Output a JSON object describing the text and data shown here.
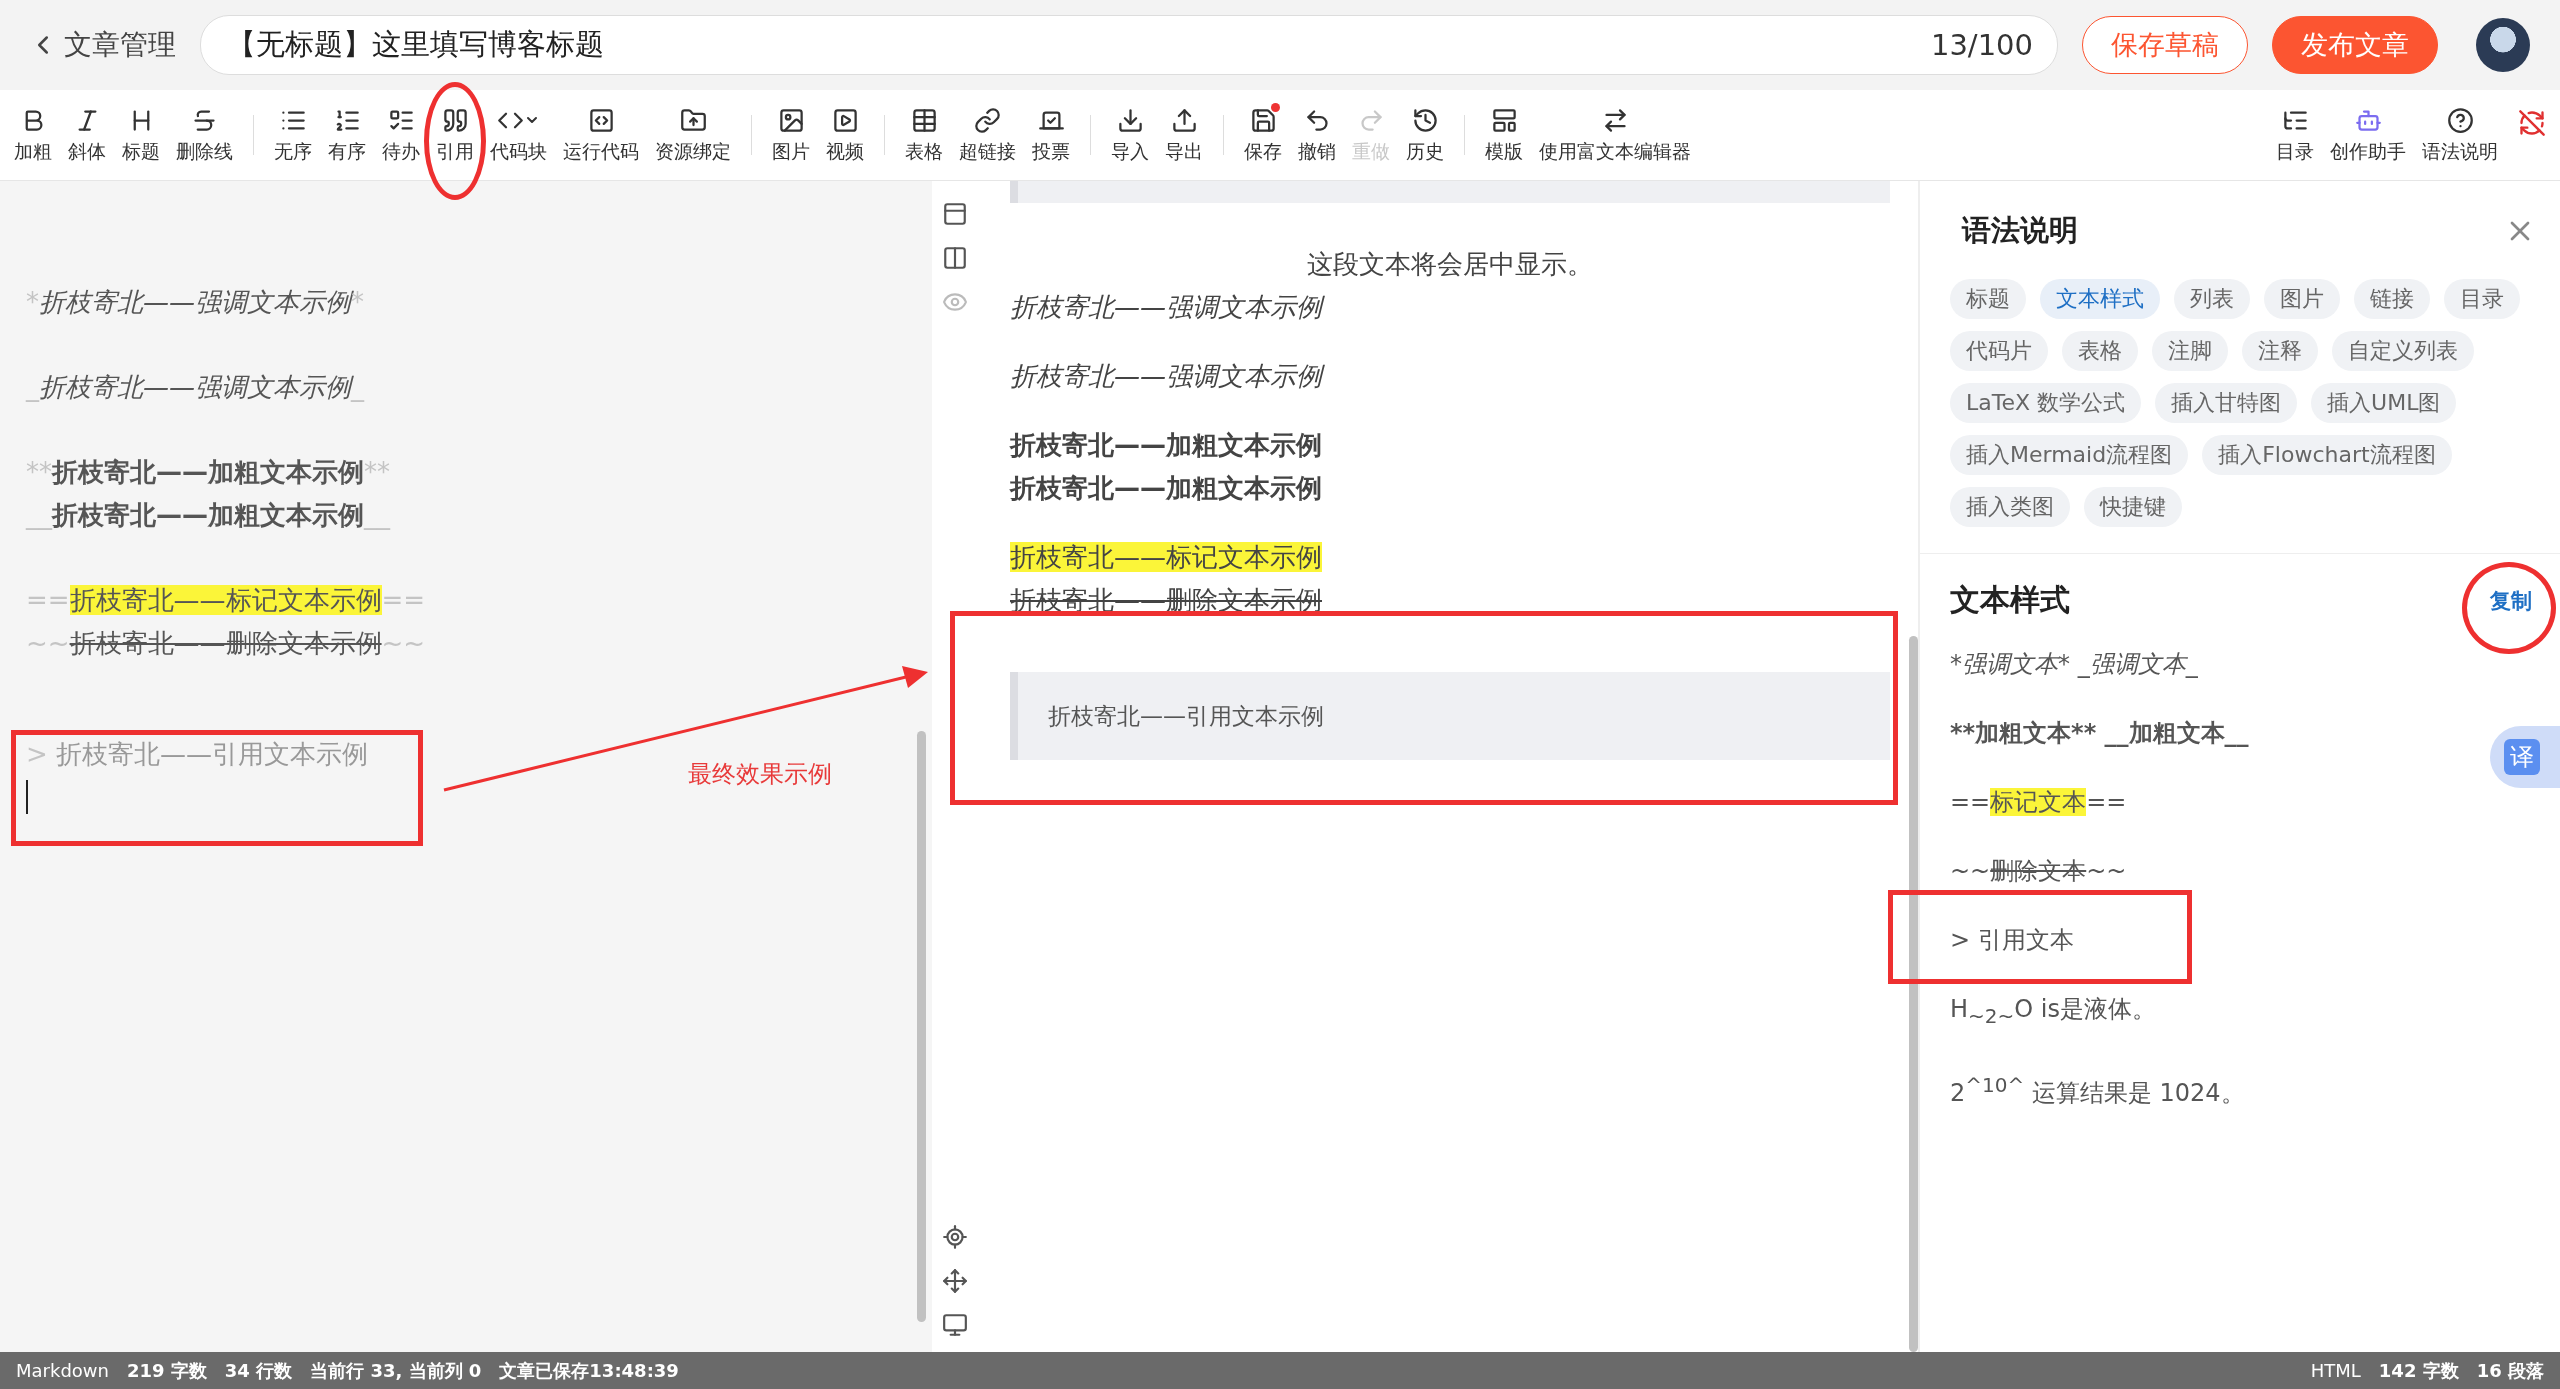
{
  "header": {
    "back_label": "文章管理",
    "title_field": {
      "value": "【无标题】这里填写博客标题"
    },
    "counter": "13/100",
    "save_draft": "保存草稿",
    "publish": "发布文章"
  },
  "toolbar": {
    "groups": [
      {
        "items": [
          {
            "label": "加粗",
            "disabled": false,
            "dot": false,
            "dropdown": false
          },
          {
            "label": "斜体",
            "disabled": false,
            "dot": false,
            "dropdown": false
          },
          {
            "label": "标题",
            "disabled": false,
            "dot": false,
            "dropdown": false
          },
          {
            "label": "删除线",
            "disabled": false,
            "dot": false,
            "dropdown": false
          }
        ]
      },
      {
        "items": [
          {
            "label": "无序",
            "disabled": false,
            "dot": false,
            "dropdown": false
          },
          {
            "label": "有序",
            "disabled": false,
            "dot": false,
            "dropdown": false
          },
          {
            "label": "待办",
            "disabled": false,
            "dot": false,
            "dropdown": false
          },
          {
            "label": "引用",
            "disabled": false,
            "dot": false,
            "dropdown": false
          },
          {
            "label": "代码块",
            "disabled": false,
            "dot": false,
            "dropdown": true
          },
          {
            "label": "运行代码",
            "disabled": false,
            "dot": false,
            "dropdown": false
          },
          {
            "label": "资源绑定",
            "disabled": false,
            "dot": false,
            "dropdown": false
          }
        ]
      },
      {
        "items": [
          {
            "label": "图片",
            "disabled": false,
            "dot": false,
            "dropdown": false
          },
          {
            "label": "视频",
            "disabled": false,
            "dot": false,
            "dropdown": false
          }
        ]
      },
      {
        "items": [
          {
            "label": "表格",
            "disabled": false,
            "dot": false,
            "dropdown": false
          },
          {
            "label": "超链接",
            "disabled": false,
            "dot": false,
            "dropdown": false
          },
          {
            "label": "投票",
            "disabled": false,
            "dot": false,
            "dropdown": false
          }
        ]
      },
      {
        "items": [
          {
            "label": "导入",
            "disabled": false,
            "dot": false,
            "dropdown": false
          },
          {
            "label": "导出",
            "disabled": false,
            "dot": false,
            "dropdown": false
          }
        ]
      },
      {
        "items": [
          {
            "label": "保存",
            "disabled": false,
            "dot": true,
            "dropdown": false
          },
          {
            "label": "撤销",
            "disabled": false,
            "dot": false,
            "dropdown": false
          },
          {
            "label": "重做",
            "disabled": true,
            "dot": false,
            "dropdown": false
          },
          {
            "label": "历史",
            "disabled": false,
            "dot": false,
            "dropdown": false
          }
        ]
      },
      {
        "items": [
          {
            "label": "模版",
            "disabled": false,
            "dot": false,
            "dropdown": false
          },
          {
            "label": "使用富文本编辑器",
            "disabled": false,
            "dot": false,
            "dropdown": false
          }
        ]
      }
    ],
    "right_items": [
      {
        "label": "目录"
      },
      {
        "label": "创作助手"
      },
      {
        "label": "语法说明"
      }
    ]
  },
  "editor": {
    "blocks": [
      {
        "lines": [
          {
            "kind": "italic",
            "prefix": "*",
            "text": "折枝寄北——强调文本示例",
            "suffix": "*"
          }
        ]
      },
      {
        "lines": [
          {
            "kind": "italic",
            "prefix": "_",
            "text": "折枝寄北——强调文本示例",
            "suffix": "_"
          }
        ]
      },
      {
        "lines": [
          {
            "kind": "bold",
            "prefix": "**",
            "text": "折枝寄北——加粗文本示例",
            "suffix": "**"
          },
          {
            "kind": "bold",
            "prefix": "__",
            "text": "折枝寄北——加粗文本示例",
            "suffix": "__"
          }
        ]
      },
      {
        "lines": [
          {
            "kind": "mark",
            "prefix": "==",
            "text": "折枝寄北——标记文本示例",
            "suffix": "=="
          },
          {
            "kind": "strike",
            "prefix": "~~",
            "text": "折枝寄北——删除文本示例",
            "suffix": "~~"
          }
        ]
      },
      {
        "lines": [
          {
            "kind": "quote",
            "prefix": ">",
            "text": "折枝寄北——引用文本示例"
          },
          {
            "kind": "cursor"
          }
        ]
      }
    ]
  },
  "annotation": {
    "label": "最终效果示例"
  },
  "preview": {
    "blocks": [
      {
        "lines": [
          {
            "kind": "center",
            "text": "这段文本将会居中显示。"
          },
          {
            "kind": "italic",
            "text": "折枝寄北——强调文本示例"
          }
        ]
      },
      {
        "lines": [
          {
            "kind": "italic",
            "text": "折枝寄北——强调文本示例"
          }
        ]
      },
      {
        "lines": [
          {
            "kind": "bold",
            "text": "折枝寄北——加粗文本示例"
          },
          {
            "kind": "bold",
            "text": "折枝寄北——加粗文本示例"
          }
        ]
      },
      {
        "lines": [
          {
            "kind": "mark",
            "text": "折枝寄北——标记文本示例"
          },
          {
            "kind": "strike",
            "text": "折枝寄北——删除文本示例"
          }
        ]
      },
      {
        "lines": [
          {
            "kind": "quote",
            "text": "折枝寄北——引用文本示例"
          }
        ]
      }
    ]
  },
  "help_panel": {
    "title": "语法说明",
    "tags": [
      {
        "label": "标题",
        "selected": false
      },
      {
        "label": "文本样式",
        "selected": true
      },
      {
        "label": "列表",
        "selected": false
      },
      {
        "label": "图片",
        "selected": false
      },
      {
        "label": "链接",
        "selected": false
      },
      {
        "label": "目录",
        "selected": false
      },
      {
        "label": "代码片",
        "selected": false
      },
      {
        "label": "表格",
        "selected": false
      },
      {
        "label": "注脚",
        "selected": false
      },
      {
        "label": "注释",
        "selected": false
      },
      {
        "label": "自定义列表",
        "selected": false
      },
      {
        "label": "LaTeX 数学公式",
        "selected": false
      },
      {
        "label": "插入甘特图",
        "selected": false
      },
      {
        "label": "插入UML图",
        "selected": false
      },
      {
        "label": "插入Mermaid流程图",
        "selected": false
      },
      {
        "label": "插入Flowchart流程图",
        "selected": false
      },
      {
        "label": "插入类图",
        "selected": false
      },
      {
        "label": "快捷键",
        "selected": false
      }
    ],
    "section_title": "文本样式",
    "copy": "复制",
    "examples": [
      {
        "kind": "italic",
        "text": "*强调文本* _强调文本_"
      },
      {
        "kind": "bold",
        "text": "**加粗文本** __加粗文本__"
      },
      {
        "kind": "mark",
        "prefix": "==",
        "text": "标记文本",
        "suffix": "=="
      },
      {
        "kind": "strike",
        "prefix": "~~",
        "text": "删除文本",
        "suffix": "~~"
      },
      {
        "kind": "plain",
        "text": "> 引用文本"
      },
      {
        "kind": "formula",
        "text": "H$_{~2~}$O is是液体。"
      },
      {
        "kind": "formula",
        "text": "2$^{^10^}$ 运算结果是 1024。"
      }
    ]
  },
  "translate_button": "译",
  "status_bar": {
    "left": [
      "Markdown",
      "219 字数",
      "34 行数",
      "当前行 33, 当前列 0",
      "文章已保存13:48:39"
    ],
    "right": [
      "HTML",
      "142 字数",
      "16 段落"
    ]
  }
}
